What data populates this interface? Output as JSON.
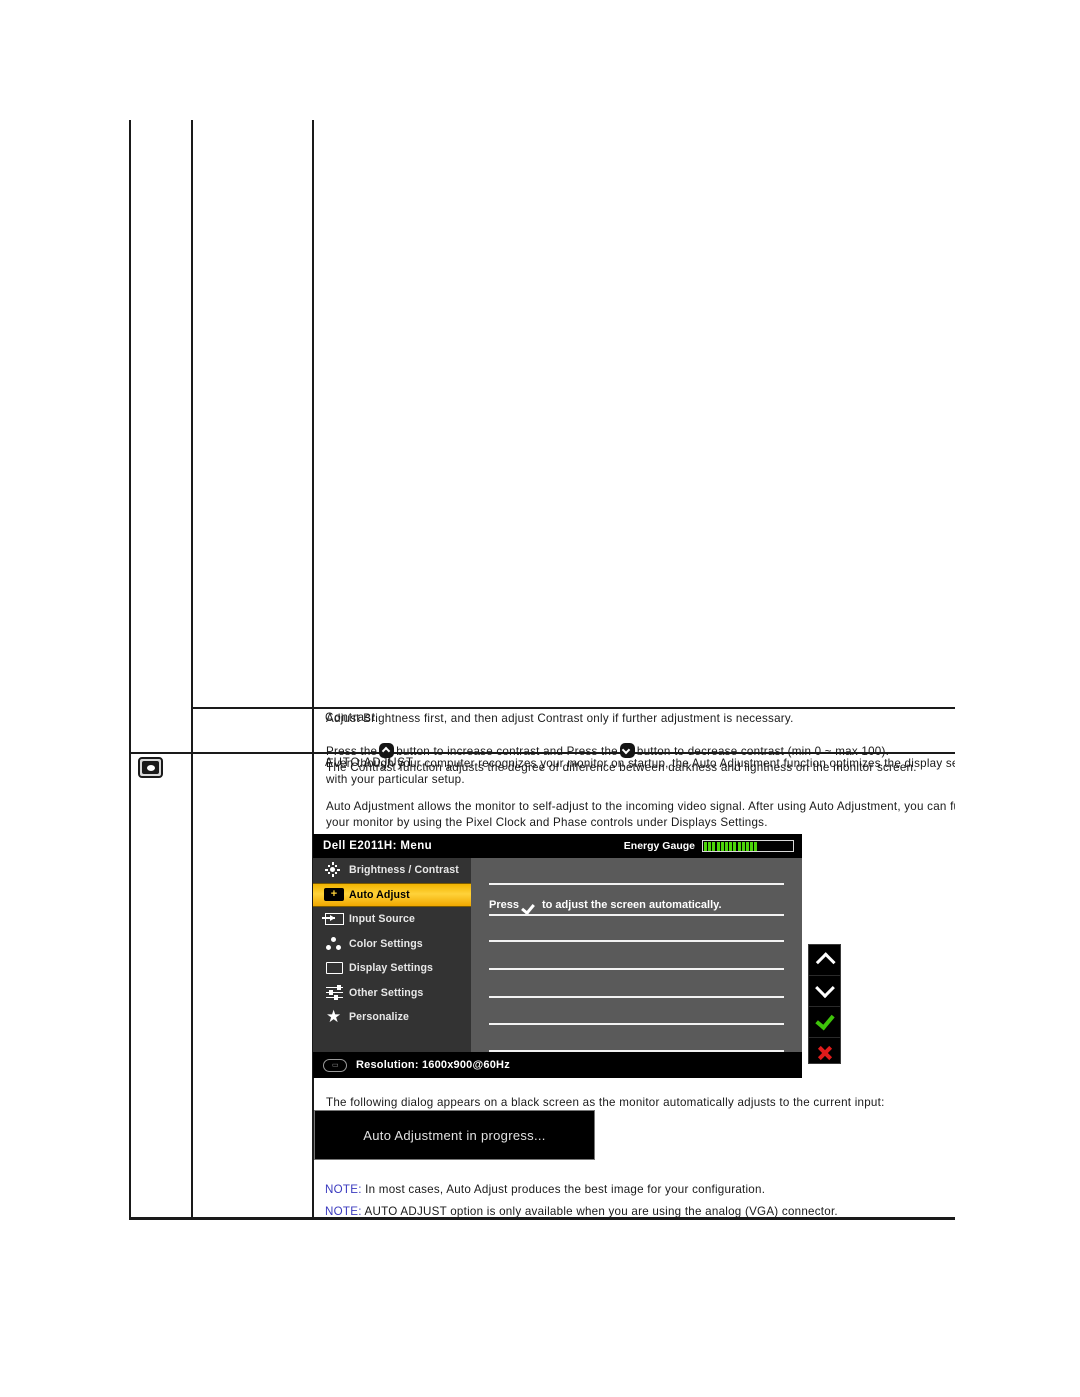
{
  "document": {
    "rows": [
      {
        "label": "Contrast",
        "paragraphs": [
          "Adjust Brightness first, and then adjust Contrast only if further adjustment is necessary.",
          "The Contrast function adjusts the degree of difference between darkness and lightness on the monitor screen."
        ],
        "press_line": {
          "before": "Press the",
          "middle": "button to increase contrast and Press the",
          "after": "button to decrease contrast (min 0 ~ max 100).",
          "up_icon": "chevron-up-icon",
          "down_icon": "chevron-down-icon"
        }
      },
      {
        "label": "AUTO ADJUST",
        "icon": "auto-adjust-icon",
        "paragraph_1_line_1": "Even though your computer recognizes your monitor on startup, the Auto Adjustment function optimizes the display settings",
        "paragraph_1_line_2": "with your particular setup.",
        "paragraph_2_line_1": "Auto Adjustment allows the monitor to self-adjust to the incoming video signal. After using Auto Adjustment, you can further t",
        "paragraph_2_line_2": "your monitor by using the Pixel Clock and Phase controls under Displays Settings.",
        "dialog_intro": "The following dialog appears on a black screen as the monitor automatically adjusts to the current input:",
        "notes": [
          {
            "tag": "NOTE:",
            "text": " In most cases, Auto Adjust produces the best image for your configuration."
          },
          {
            "tag": "NOTE:",
            "text": " AUTO ADJUST option is only available when you are using the analog (VGA) connector."
          }
        ]
      }
    ]
  },
  "osd": {
    "title": "Dell E2011H: Menu",
    "energy_label": "Energy Gauge",
    "energy_segments_total": 17,
    "energy_segments_filled": 13,
    "menu_items": [
      {
        "label": "Brightness / Contrast",
        "icon": "brightness-icon",
        "active": false
      },
      {
        "label": "Auto Adjust",
        "icon": "auto-adjust-icon",
        "active": true
      },
      {
        "label": "Input Source",
        "icon": "input-source-icon",
        "active": false
      },
      {
        "label": "Color Settings",
        "icon": "color-settings-icon",
        "active": false
      },
      {
        "label": "Display Settings",
        "icon": "display-settings-icon",
        "active": false
      },
      {
        "label": "Other Settings",
        "icon": "other-settings-icon",
        "active": false
      },
      {
        "label": "Personalize",
        "icon": "star-icon",
        "active": false
      }
    ],
    "content": {
      "press_before": "Press",
      "press_after": "to adjust the screen automatically.",
      "check_icon": "check-icon",
      "divider_count": 7
    },
    "footer": {
      "resolution_icon": "monitor-icon",
      "resolution_text": "Resolution: 1600x900@60Hz"
    },
    "colors": {
      "highlight": "#f0b400",
      "panel": "#5a5a5a",
      "sidebar": "#333333",
      "header": "#000000",
      "gauge_green": "#4cd40a"
    }
  },
  "osd_buttons": [
    {
      "name": "up-button",
      "icon": "chevron-up-icon",
      "color": "#ffffff"
    },
    {
      "name": "down-button",
      "icon": "chevron-down-icon",
      "color": "#ffffff"
    },
    {
      "name": "ok-button",
      "icon": "check-icon",
      "color": "#3ec40a"
    },
    {
      "name": "exit-button",
      "icon": "close-icon",
      "color": "#e01b1b"
    }
  ],
  "progress_dialog": {
    "message": "Auto Adjustment in progress..."
  }
}
